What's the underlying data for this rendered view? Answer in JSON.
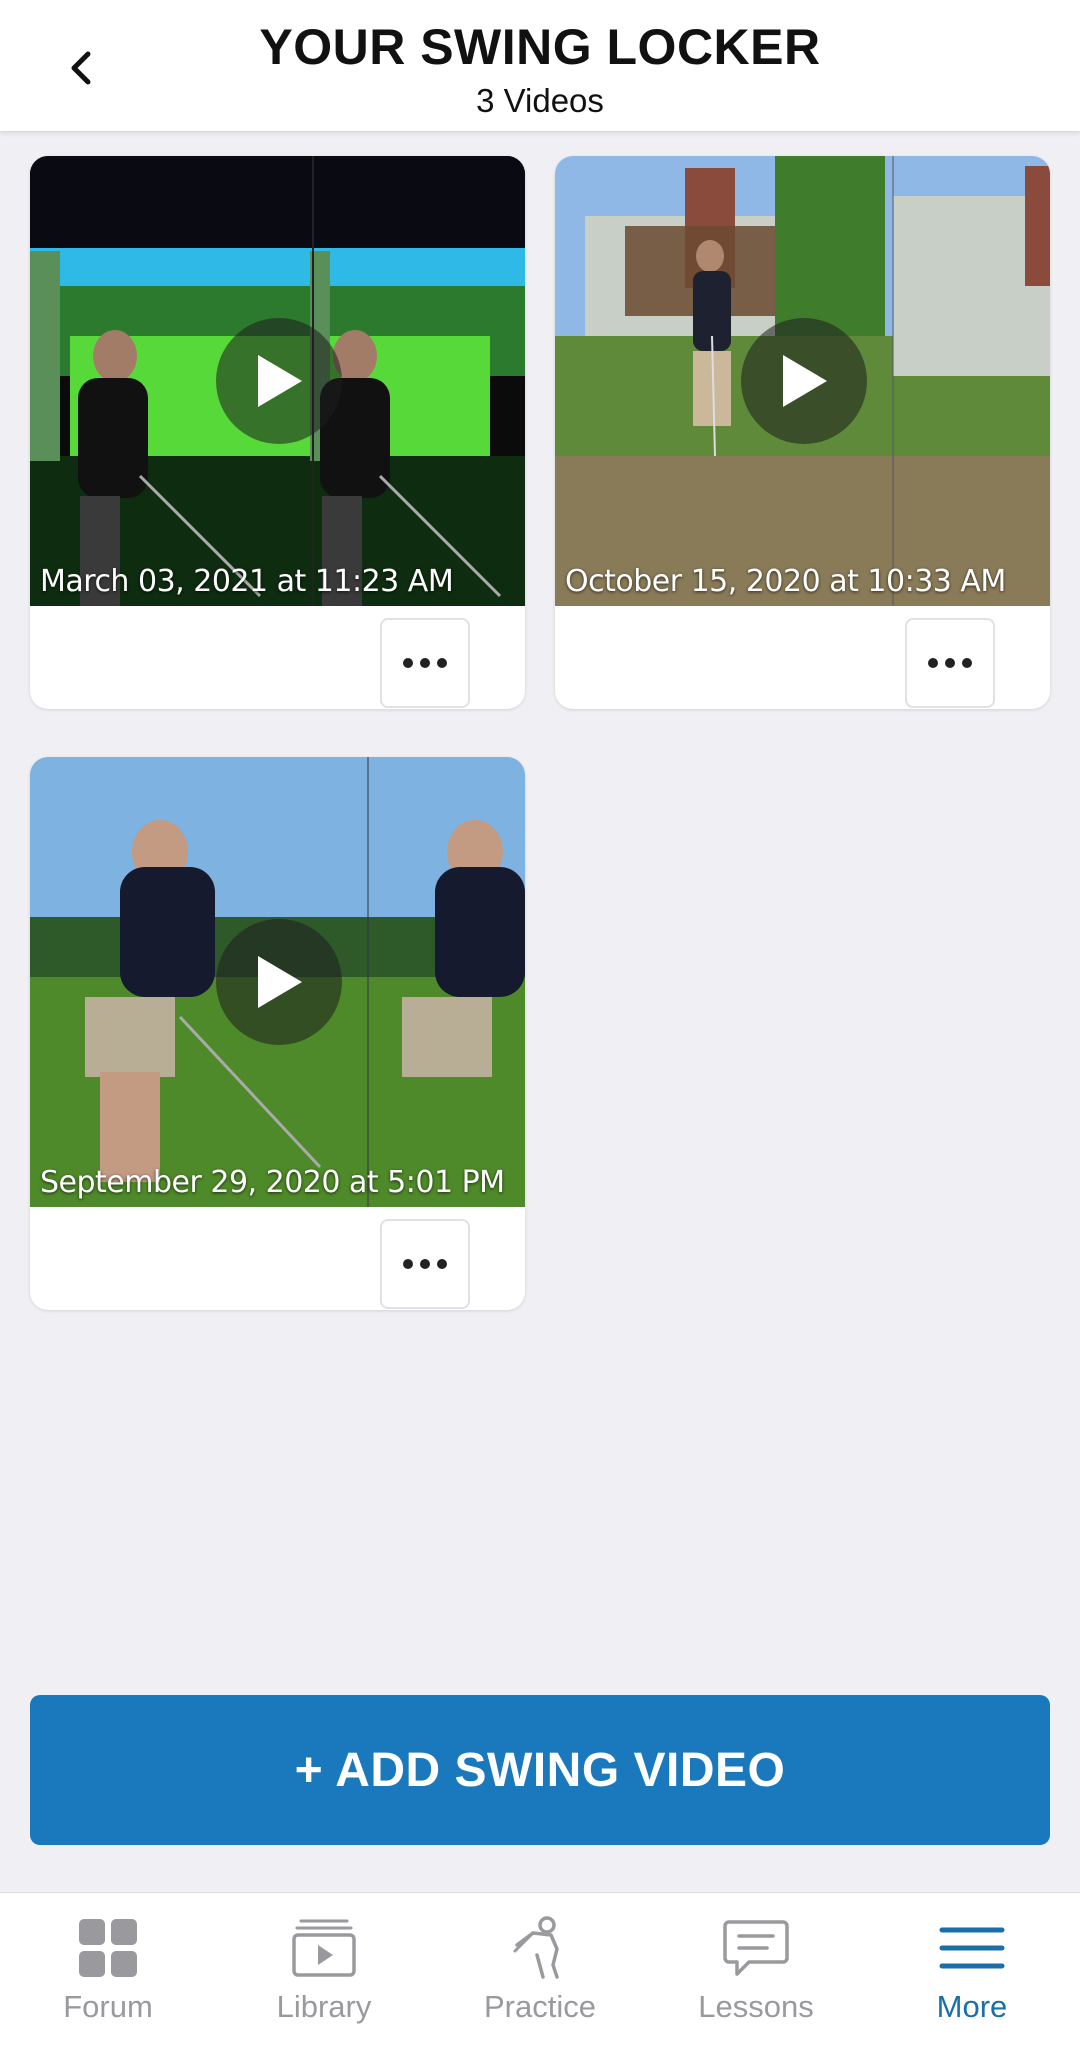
{
  "header": {
    "title": "YOUR SWING LOCKER",
    "subtitle": "3 Videos"
  },
  "videos": [
    {
      "date": "March 03, 2021 at 11:23 AM"
    },
    {
      "date": "October 15, 2020 at 10:33 AM"
    },
    {
      "date": "September 29, 2020 at 5:01 PM"
    }
  ],
  "add_button": {
    "label": "+ ADD SWING VIDEO"
  },
  "tabs": [
    {
      "label": "Forum",
      "icon": "grid-icon"
    },
    {
      "label": "Library",
      "icon": "library-icon"
    },
    {
      "label": "Practice",
      "icon": "golfer-icon"
    },
    {
      "label": "Lessons",
      "icon": "chat-icon"
    },
    {
      "label": "More",
      "icon": "menu-icon",
      "active": true
    }
  ],
  "colors": {
    "accent": "#1a79bd",
    "active_tab": "#1a6fa8",
    "inactive_tab": "#9a9a9e",
    "background": "#efeff4"
  }
}
